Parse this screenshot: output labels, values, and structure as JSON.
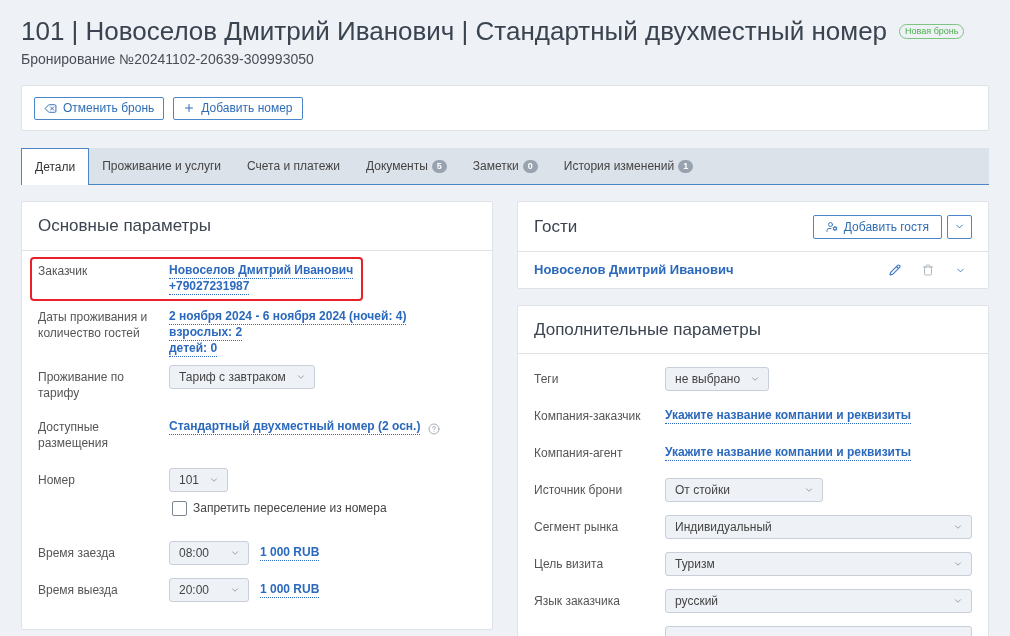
{
  "header": {
    "title": "101 | Новоселов Дмитрий Иванович | Стандартный двухместный номер",
    "badge": "Новая бронь",
    "subtitle": "Бронирование №20241102-20639-309993050"
  },
  "toolbar": {
    "buttons": [
      {
        "kind": "cancel",
        "label": "Отменить бронь"
      },
      {
        "kind": "add",
        "label": "Добавить номер"
      }
    ]
  },
  "tabs": [
    {
      "label": "Детали",
      "selected": true
    },
    {
      "label": "Проживание и услуги",
      "selected": false
    },
    {
      "label": "Счета и платежи",
      "selected": false
    },
    {
      "label": "Документы",
      "count": "5",
      "selected": false
    },
    {
      "label": "Заметки",
      "count": "0",
      "selected": false
    },
    {
      "label": "История изменений",
      "count": "1",
      "selected": false
    }
  ],
  "main_params": {
    "title": "Основные параметры",
    "rows": [
      {
        "kind": "links",
        "label": "Заказчик",
        "highlighted": true,
        "links": [
          "Новоселов Дмитрий Иванович",
          "+79027231987"
        ]
      },
      {
        "kind": "links",
        "label": "Даты проживания и количество гостей",
        "links": [
          "2 ноября 2024 - 6 ноября 2024 (ночей: 4)",
          "взрослых: 2",
          "детей: 0"
        ]
      },
      {
        "kind": "select",
        "label": "Проживание по тарифу",
        "value": "Тариф с завтраком"
      },
      {
        "kind": "links",
        "label": "Доступные размещения",
        "help": true,
        "links": [
          "Стандартный двухместный номер (2 осн.)"
        ]
      },
      {
        "kind": "room",
        "label": "Номер",
        "value": "101",
        "checkbox": {
          "label": "Запретить переселение из номера",
          "checked": false
        }
      },
      {
        "kind": "time",
        "label": "Время заезда",
        "value": "08:00",
        "price": "1 000 RUB"
      },
      {
        "kind": "time",
        "label": "Время выезда",
        "value": "20:00",
        "price": "1 000 RUB"
      }
    ]
  },
  "guests": {
    "title": "Гости",
    "add_button": "Добавить гостя",
    "list": [
      {
        "name": "Новоселов Дмитрий Иванович",
        "expanded": false
      }
    ]
  },
  "additional_params": {
    "title": "Дополнительные параметры",
    "rows": [
      {
        "kind": "tags",
        "label": "Теги",
        "value": "не выбрано"
      },
      {
        "kind": "link",
        "label": "Компания-заказчик",
        "value": "Укажите название компании и реквизиты"
      },
      {
        "kind": "link",
        "label": "Компания-агент",
        "value": "Укажите название компании и реквизиты"
      },
      {
        "kind": "select",
        "label": "Источник брони",
        "value": "От стойки"
      },
      {
        "kind": "select",
        "label": "Сегмент рынка",
        "value": "Индивидуальный"
      },
      {
        "kind": "select",
        "label": "Цель визита",
        "value": "Туризм"
      },
      {
        "kind": "select",
        "label": "Язык заказчика",
        "value": "русский"
      },
      {
        "kind": "select"
      }
    ]
  }
}
